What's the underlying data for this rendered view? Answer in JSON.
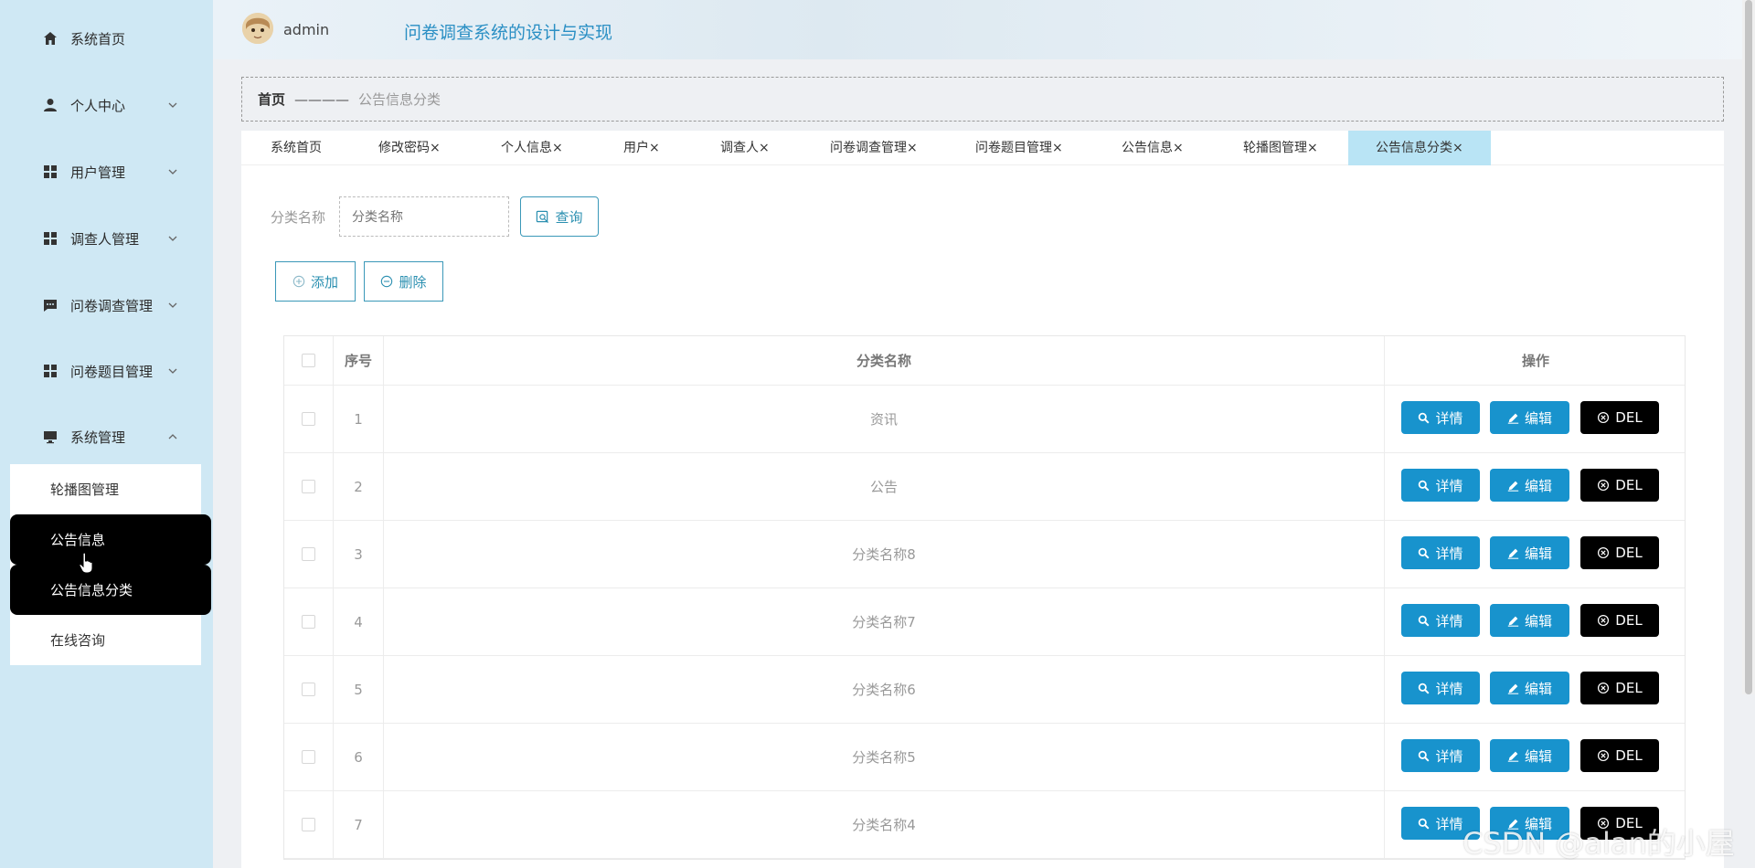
{
  "sidebar": {
    "items": [
      {
        "label": "系统首页",
        "icon": "home-icon"
      },
      {
        "label": "个人中心",
        "icon": "user-icon"
      },
      {
        "label": "用户管理",
        "icon": "grid-icon"
      },
      {
        "label": "调查人管理",
        "icon": "grid-icon"
      },
      {
        "label": "问卷调查管理",
        "icon": "chat-icon"
      },
      {
        "label": "问卷题目管理",
        "icon": "grid-icon"
      },
      {
        "label": "系统管理",
        "icon": "monitor-icon"
      }
    ],
    "submenu": [
      "轮播图管理",
      "公告信息",
      "公告信息分类",
      "在线咨询"
    ]
  },
  "header": {
    "username": "admin",
    "title": "问卷调查系统的设计与实现"
  },
  "breadcrumb": {
    "home": "首页",
    "separator": "————",
    "current": "公告信息分类"
  },
  "tabs": [
    "系统首页",
    "修改密码×",
    "个人信息×",
    "用户×",
    "调查人×",
    "问卷调查管理×",
    "问卷题目管理×",
    "公告信息×",
    "轮播图管理×",
    "公告信息分类×"
  ],
  "search": {
    "label": "分类名称",
    "placeholder": "分类名称",
    "button": "查询"
  },
  "actions": {
    "add": "添加",
    "delete": "删除"
  },
  "table": {
    "headers": {
      "index": "序号",
      "name": "分类名称",
      "ops": "操作"
    },
    "rows": [
      {
        "index": "1",
        "name": "资讯"
      },
      {
        "index": "2",
        "name": "公告"
      },
      {
        "index": "3",
        "name": "分类名称8"
      },
      {
        "index": "4",
        "name": "分类名称7"
      },
      {
        "index": "5",
        "name": "分类名称6"
      },
      {
        "index": "6",
        "name": "分类名称5"
      },
      {
        "index": "7",
        "name": "分类名称4"
      }
    ],
    "op_labels": {
      "detail": "详情",
      "edit": "编辑",
      "del": "DEL"
    }
  },
  "watermark": "CSDN @alan的小屋",
  "colors": {
    "accent": "#1893cd",
    "sidebar": "#cfe8f4",
    "active_tab": "#b9e4f5",
    "title": "#2a8fc4"
  }
}
